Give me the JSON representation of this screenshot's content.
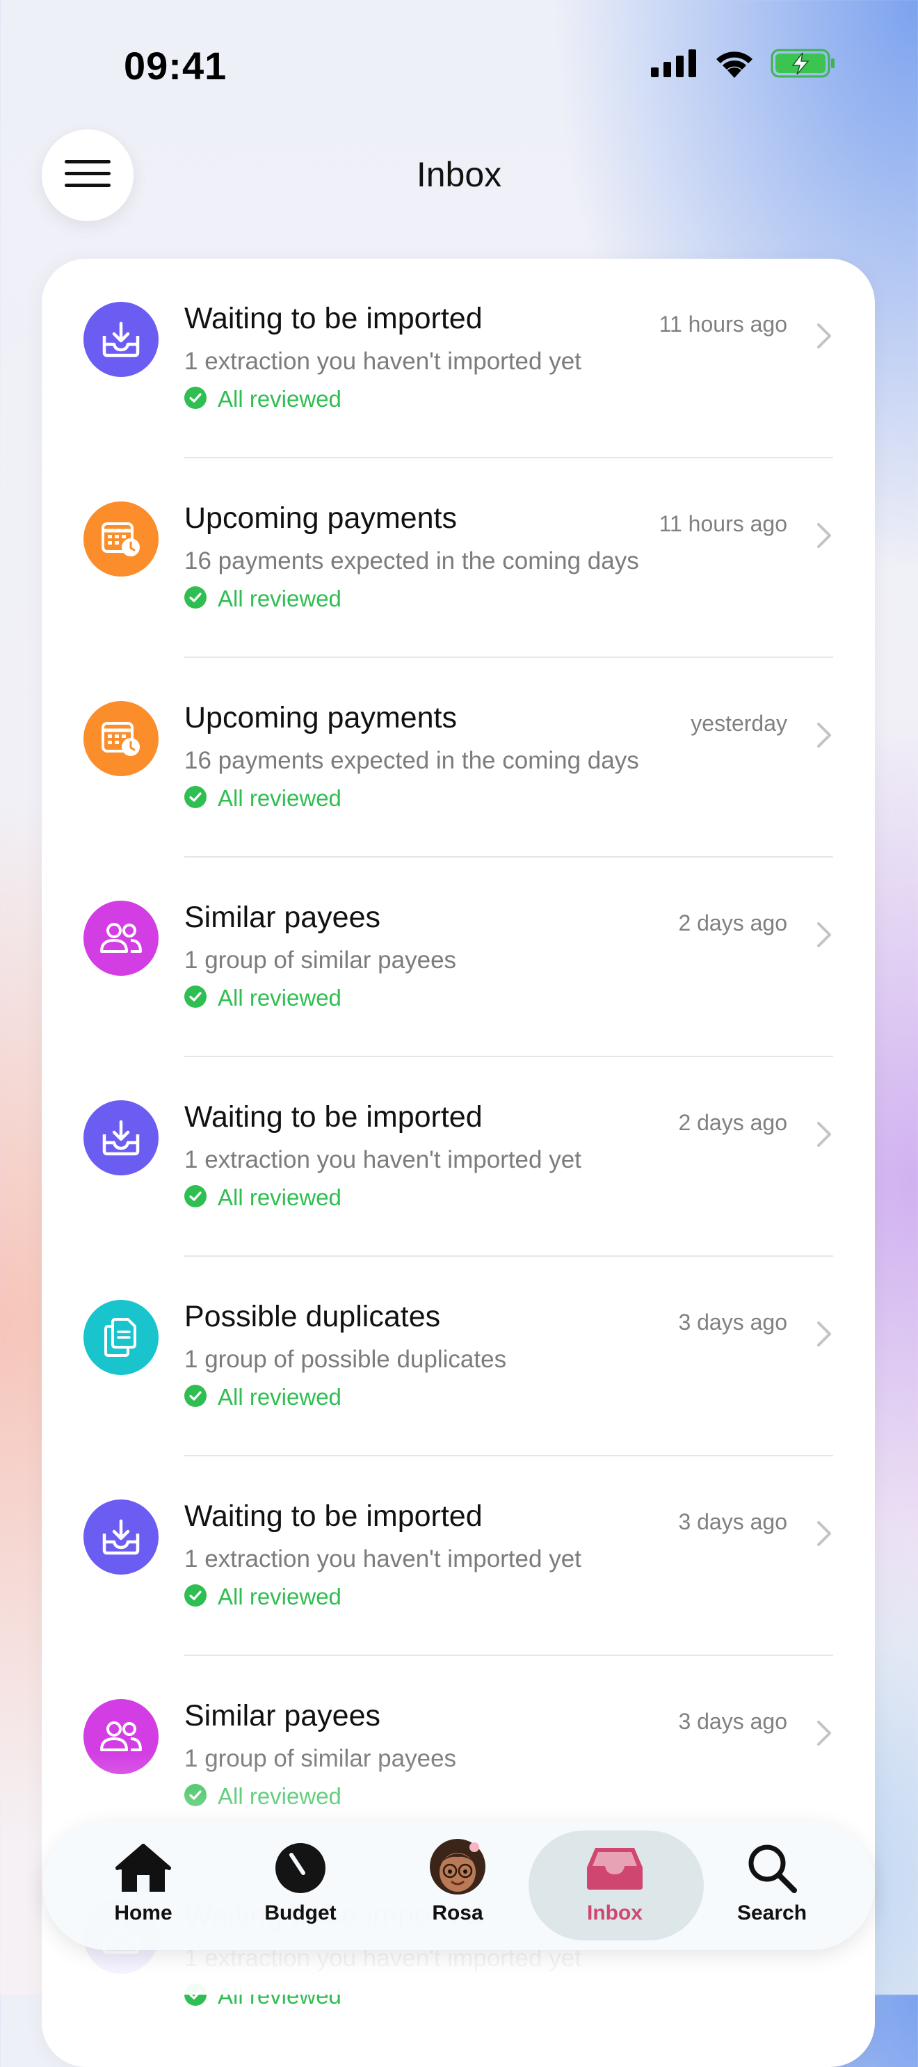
{
  "status_bar": {
    "time": "09:41",
    "icons": [
      "cellular-signal-icon",
      "wifi-icon",
      "battery-charging-icon"
    ]
  },
  "header": {
    "title": "Inbox",
    "menu_icon": "hamburger-menu-icon"
  },
  "colors": {
    "import": "#6b5cf2",
    "payments": "#fb8d2b",
    "payees": "#d23ee3",
    "duplicates": "#19c4cd",
    "reviewed_green": "#2fbe51",
    "active_tab": "#cf4770"
  },
  "inbox": {
    "items": [
      {
        "kind": "import",
        "icon": "inbox-download-icon",
        "title": "Waiting to be imported",
        "time": "11 hours ago",
        "subtitle": "1 extraction you haven't imported yet",
        "status": "All reviewed"
      },
      {
        "kind": "payments",
        "icon": "calendar-clock-icon",
        "title": "Upcoming payments",
        "time": "11 hours ago",
        "subtitle": "16 payments expected in the coming days",
        "status": "All reviewed"
      },
      {
        "kind": "payments",
        "icon": "calendar-clock-icon",
        "title": "Upcoming payments",
        "time": "yesterday",
        "subtitle": "16 payments expected in the coming days",
        "status": "All reviewed"
      },
      {
        "kind": "payees",
        "icon": "people-group-icon",
        "title": "Similar payees",
        "time": "2 days ago",
        "subtitle": "1 group of similar payees",
        "status": "All reviewed"
      },
      {
        "kind": "import",
        "icon": "inbox-download-icon",
        "title": "Waiting to be imported",
        "time": "2 days ago",
        "subtitle": "1 extraction you haven't imported yet",
        "status": "All reviewed"
      },
      {
        "kind": "duplicates",
        "icon": "duplicate-documents-icon",
        "title": "Possible duplicates",
        "time": "3 days ago",
        "subtitle": "1 group of possible duplicates",
        "status": "All reviewed"
      },
      {
        "kind": "import",
        "icon": "inbox-download-icon",
        "title": "Waiting to be imported",
        "time": "3 days ago",
        "subtitle": "1 extraction you haven't imported yet",
        "status": "All reviewed"
      },
      {
        "kind": "payees",
        "icon": "people-group-icon",
        "title": "Similar payees",
        "time": "3 days ago",
        "subtitle": "1 group of similar payees",
        "status": "All reviewed"
      },
      {
        "kind": "import",
        "icon": "inbox-download-icon",
        "title": "Waiting to be imported",
        "time": "",
        "subtitle": "1 extraction you haven't imported yet",
        "status": "All reviewed"
      }
    ]
  },
  "tabbar": {
    "tabs": [
      {
        "label": "Home",
        "icon": "house-icon"
      },
      {
        "label": "Budget",
        "icon": "gauge-icon"
      },
      {
        "label": "Rosa",
        "icon": "avatar-icon"
      },
      {
        "label": "Inbox",
        "icon": "tray-icon",
        "active": true
      },
      {
        "label": "Search",
        "icon": "magnifier-icon"
      }
    ]
  }
}
